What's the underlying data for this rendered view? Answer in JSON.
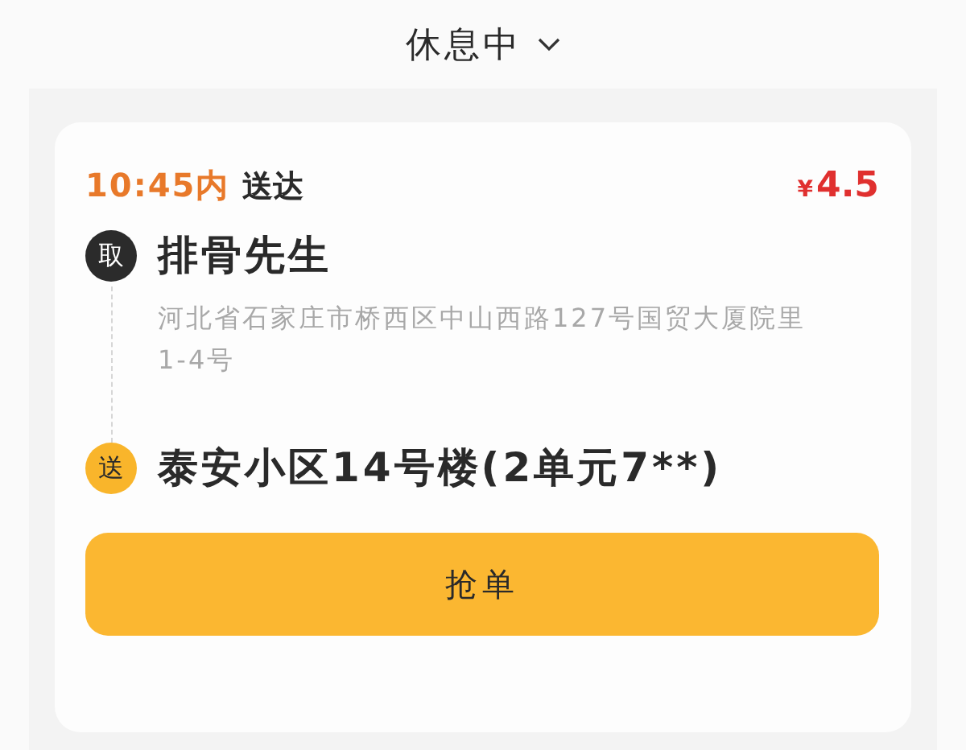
{
  "header": {
    "status": "休息中"
  },
  "order": {
    "deadline": "10:45内",
    "deadline_suffix": "送达",
    "price_symbol": "¥",
    "price": "4.5",
    "stops": [
      {
        "kind": "pickup",
        "badge": "取",
        "title": "排骨先生",
        "address": "河北省石家庄市桥西区中山西路127号国贸大厦院里1-4号"
      },
      {
        "kind": "delivery",
        "badge": "送",
        "title": "泰安小区14号楼(2单元7**)"
      }
    ],
    "action": "抢单"
  }
}
